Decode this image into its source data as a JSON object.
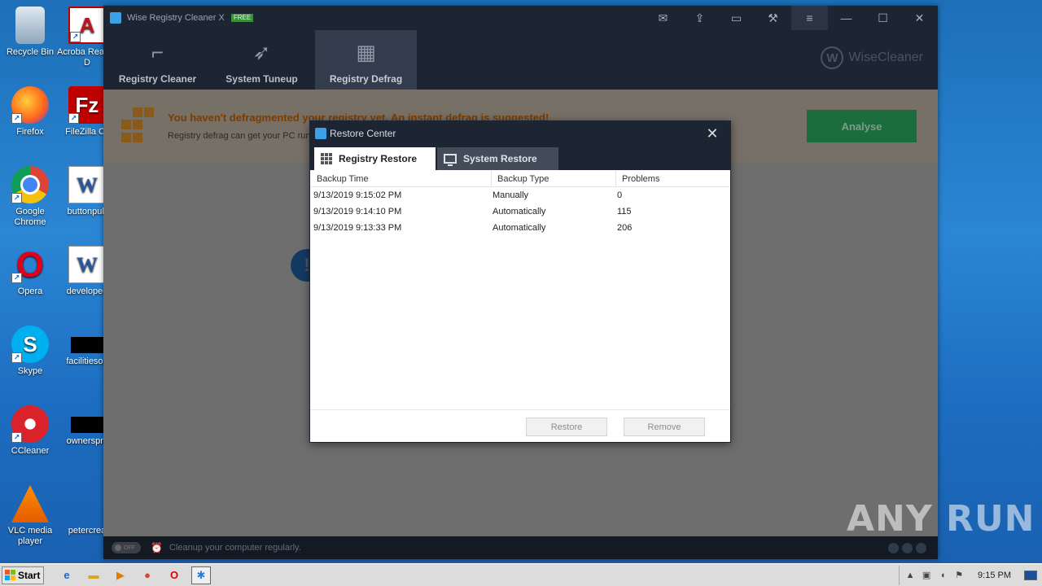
{
  "desktop": {
    "icons": [
      {
        "label": "Recycle Bin",
        "icon": "recycle-bin-icon"
      },
      {
        "label": "Acroba Reader D",
        "icon": "acrobat-reader-icon"
      },
      {
        "label": "Firefox",
        "icon": "firefox-icon"
      },
      {
        "label": "FileZilla Cli",
        "icon": "filezilla-icon"
      },
      {
        "label": "Google Chrome",
        "icon": "chrome-icon"
      },
      {
        "label": "buttonpub",
        "icon": "word-document-icon"
      },
      {
        "label": "Opera",
        "icon": "opera-icon"
      },
      {
        "label": "developed",
        "icon": "word-document-icon"
      },
      {
        "label": "Skype",
        "icon": "skype-icon"
      },
      {
        "label": "facilitiesop",
        "icon": "file-icon"
      },
      {
        "label": "CCleaner",
        "icon": "ccleaner-icon"
      },
      {
        "label": "ownerspm",
        "icon": "file-icon"
      },
      {
        "label": "VLC media player",
        "icon": "vlc-icon"
      },
      {
        "label": "petercrea",
        "icon": "file-icon"
      }
    ]
  },
  "app": {
    "title": "Wise Registry Cleaner X",
    "badge": "FREE",
    "nav": [
      {
        "label": "Registry Cleaner",
        "icon": "broom-icon"
      },
      {
        "label": "System Tuneup",
        "icon": "rocket-icon"
      },
      {
        "label": "Registry Defrag",
        "icon": "defrag-icon"
      }
    ],
    "brand": "WiseCleaner",
    "brand_mark": "W",
    "banner": {
      "title": "You haven't defragmented your registry yet. An instant defrag is suggested!",
      "subtitle": "Registry defrag can get your PC run",
      "analyse_label": "Analyse"
    },
    "body_icon_glyph": "!",
    "status": {
      "toggle_label": "OFF",
      "text": "Cleanup your computer regularly."
    }
  },
  "dialog": {
    "title": "Restore Center",
    "close_glyph": "✕",
    "tabs": [
      {
        "label": "Registry Restore"
      },
      {
        "label": "System Restore"
      }
    ],
    "columns": [
      "Backup Time",
      "Backup Type",
      "Problems"
    ],
    "rows": [
      {
        "time": "9/13/2019 9:15:02 PM",
        "type": "Manually",
        "problems": "0"
      },
      {
        "time": "9/13/2019 9:14:10 PM",
        "type": "Automatically",
        "problems": "115"
      },
      {
        "time": "9/13/2019 9:13:33 PM",
        "type": "Automatically",
        "problems": "206"
      }
    ],
    "restore_label": "Restore",
    "remove_label": "Remove"
  },
  "watermark": "ANY RUN",
  "taskbar": {
    "start_label": "Start",
    "clock": "9:15 PM"
  },
  "colors": {
    "titlebar": "#1e2532",
    "banner_title": "#7a3c00",
    "analyse": "#1c6d3e"
  }
}
